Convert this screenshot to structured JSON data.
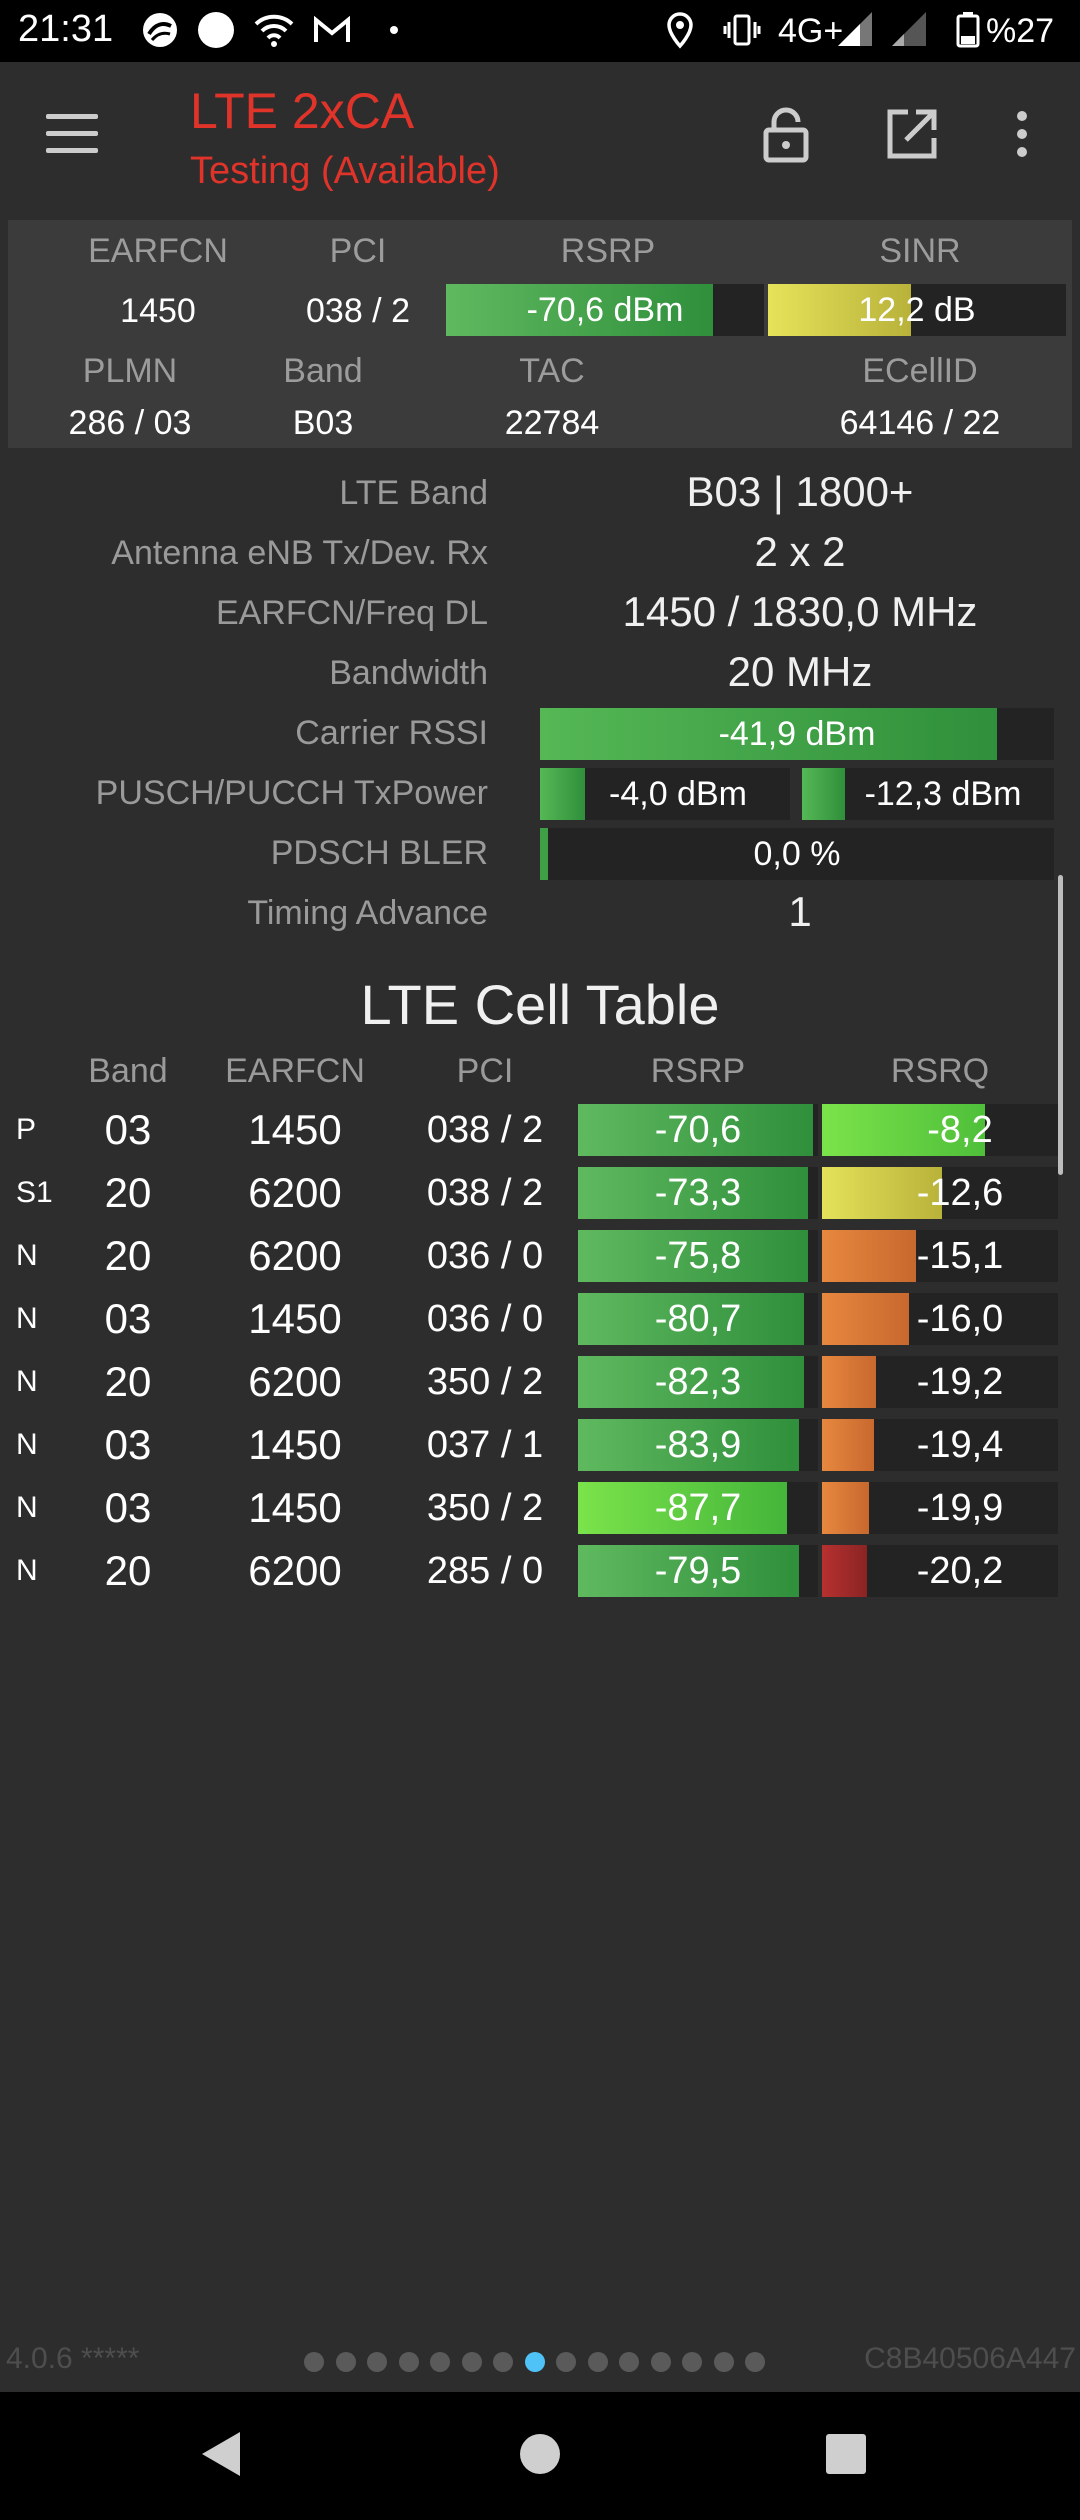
{
  "status_bar": {
    "time": "21:31",
    "network": "4G+",
    "battery": "%27"
  },
  "app_bar": {
    "title": "LTE 2xCA",
    "subtitle": "Testing (Available)",
    "actions": [
      "menu-icon",
      "lock-icon",
      "share-icon",
      "overflow-icon"
    ],
    "title_color": "#e0342b"
  },
  "summary": {
    "headers": {
      "earfcn": "EARFCN",
      "pci": "PCI",
      "rsrp": "RSRP",
      "sinr": "SINR",
      "plmn": "PLMN",
      "band": "Band",
      "tac": "TAC",
      "ecellid": "ECellID"
    },
    "earfcn": "1450",
    "pci": "038 / 2",
    "rsrp": {
      "text": "-70,6 dBm",
      "level": 0.84
    },
    "sinr": {
      "text": "12,2 dB",
      "level": 0.48
    },
    "plmn": "286 / 03",
    "band": "B03",
    "tac": "22784",
    "ecellid": "64146 / 22"
  },
  "details": {
    "lte_band_label": "LTE Band",
    "lte_band_value": "B03 | 1800+",
    "antenna_label": "Antenna eNB Tx/Dev. Rx",
    "antenna_value": "2 x 2",
    "earfcn_freq_label": "EARFCN/Freq DL",
    "earfcn_freq_value": "1450 / 1830,0 MHz",
    "bandwidth_label": "Bandwidth",
    "bandwidth_value": "20 MHz",
    "rssi_label": "Carrier RSSI",
    "rssi": {
      "text": "-41,9 dBm",
      "level": 0.89
    },
    "txpower_label": "PUSCH/PUCCH TxPower",
    "pusch": {
      "text": "-4,0 dBm",
      "level": 0.18
    },
    "pucch": {
      "text": "-12,3 dBm",
      "level": 0.17
    },
    "bler_label": "PDSCH BLER",
    "bler": {
      "text": "0,0 %",
      "level": 0.015
    },
    "timing_label": "Timing Advance",
    "timing_value": "1"
  },
  "cell_table": {
    "title": "LTE Cell Table",
    "headers": {
      "band": "Band",
      "earfcn": "EARFCN",
      "pci": "PCI",
      "rsrp": "RSRP",
      "rsrq": "RSRQ"
    },
    "rows": [
      {
        "type": "P",
        "band": "03",
        "earfcn": "1450",
        "pci": "038 / 2",
        "rsrp": "-70,6",
        "rsrp_level": 0.98,
        "rsrq": "-8,2",
        "rsrq_level": 0.69
      },
      {
        "type": "S1",
        "band": "20",
        "earfcn": "6200",
        "pci": "038 / 2",
        "rsrp": "-73,3",
        "rsrp_level": 0.96,
        "rsrq": "-12,6",
        "rsrq_level": 0.51
      },
      {
        "type": "N",
        "band": "20",
        "earfcn": "6200",
        "pci": "036 / 0",
        "rsrp": "-75,8",
        "rsrp_level": 0.96,
        "rsrq": "-15,1",
        "rsrq_level": 0.4
      },
      {
        "type": "N",
        "band": "03",
        "earfcn": "1450",
        "pci": "036 / 0",
        "rsrp": "-80,7",
        "rsrp_level": 0.94,
        "rsrq": "-16,0",
        "rsrq_level": 0.37
      },
      {
        "type": "N",
        "band": "20",
        "earfcn": "6200",
        "pci": "350 / 2",
        "rsrp": "-82,3",
        "rsrp_level": 0.94,
        "rsrq": "-19,2",
        "rsrq_level": 0.23
      },
      {
        "type": "N",
        "band": "03",
        "earfcn": "1450",
        "pci": "037 / 1",
        "rsrp": "-83,9",
        "rsrp_level": 0.92,
        "rsrq": "-19,4",
        "rsrq_level": 0.22
      },
      {
        "type": "N",
        "band": "03",
        "earfcn": "1450",
        "pci": "350 / 2",
        "rsrp": "-87,7",
        "rsrp_level": 0.87,
        "rsrq": "-19,9",
        "rsrq_level": 0.2
      },
      {
        "type": "N",
        "band": "20",
        "earfcn": "6200",
        "pci": "285 / 0",
        "rsrp": "-79,5",
        "rsrp_level": 0.92,
        "rsrq": "-20,2",
        "rsrq_level": 0.19
      }
    ]
  },
  "pager": {
    "count": 15,
    "active_index": 7
  },
  "footer": {
    "version": "4.0.6 *****",
    "device_id": "C8B40506A447"
  }
}
